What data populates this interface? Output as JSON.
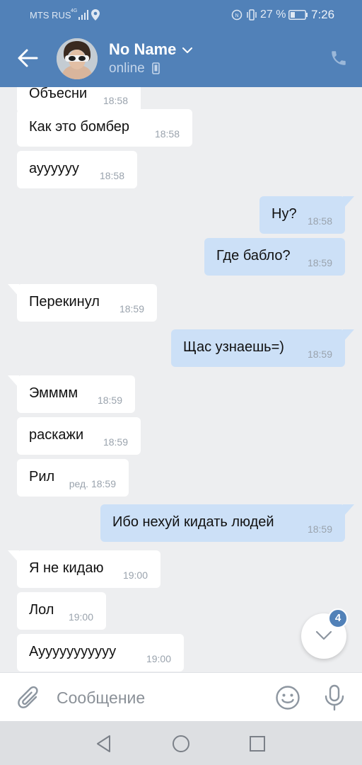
{
  "status_bar": {
    "carrier": "MTS RUS",
    "network": "4G",
    "battery_percent": "27 %",
    "time": "7:26"
  },
  "header": {
    "contact_name": "No Name",
    "contact_status": "online"
  },
  "messages": [
    {
      "direction": "in",
      "text": "Объесни",
      "time": "18:58"
    },
    {
      "direction": "in",
      "text": "Как это бомбер",
      "time": "18:58"
    },
    {
      "direction": "in",
      "text": "ауууууу",
      "time": "18:58"
    },
    {
      "direction": "out",
      "text": "Ну?",
      "time": "18:58"
    },
    {
      "direction": "out",
      "text": "Где бабло?",
      "time": "18:59"
    },
    {
      "direction": "in",
      "text": "Перекинул",
      "time": "18:59"
    },
    {
      "direction": "out",
      "text": "Щас узнаешь=)",
      "time": "18:59"
    },
    {
      "direction": "in",
      "text": "Эмммм",
      "time": "18:59"
    },
    {
      "direction": "in",
      "text": "раскажи",
      "time": "18:59"
    },
    {
      "direction": "in",
      "text": "Рил",
      "time": "ред. 18:59"
    },
    {
      "direction": "out",
      "text": "Ибо нехуй кидать людей",
      "time": "18:59"
    },
    {
      "direction": "in",
      "text": "Я не кидаю",
      "time": "19:00"
    },
    {
      "direction": "in",
      "text": "Лол",
      "time": "19:00"
    },
    {
      "direction": "in",
      "text": "Аууууууууууу",
      "time": "19:00"
    }
  ],
  "scroll_down": {
    "unread_count": "4"
  },
  "composer": {
    "placeholder": "Сообщение"
  },
  "colors": {
    "header": "#5181b8",
    "incoming_bubble": "#ffffff",
    "outgoing_bubble": "#cce0f7",
    "background": "#edeef0"
  }
}
